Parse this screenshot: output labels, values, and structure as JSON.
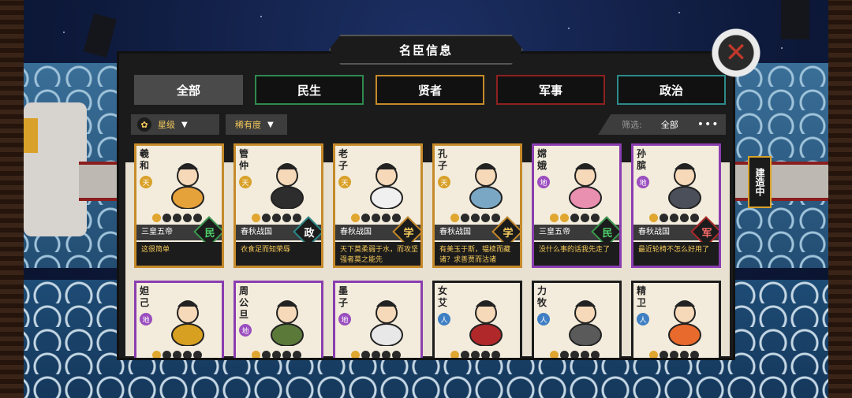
{
  "title": "名臣信息",
  "close_label": "✕",
  "tabs": [
    {
      "label": "全部",
      "active": true
    },
    {
      "label": "民生"
    },
    {
      "label": "贤者"
    },
    {
      "label": "军事"
    },
    {
      "label": "政治"
    }
  ],
  "filters": {
    "star_icon": "✿",
    "star_label": "星级",
    "rarity_label": "稀有度",
    "screen_label": "筛选:",
    "screen_value": "全部",
    "more": "•••"
  },
  "side_button": "建造中",
  "cards": [
    {
      "name": "羲和",
      "grade": "天",
      "era": "三皇五帝",
      "category": "民",
      "quote": "这很简单",
      "stars": 1
    },
    {
      "name": "管仲",
      "grade": "天",
      "era": "春秋战国",
      "category": "政",
      "quote": "衣食足而知荣辱",
      "stars": 1
    },
    {
      "name": "老子",
      "grade": "天",
      "era": "春秋战国",
      "category": "学",
      "quote": "天下莫柔弱于水，而攻坚强者莫之能先",
      "stars": 1
    },
    {
      "name": "孔子",
      "grade": "天",
      "era": "春秋战国",
      "category": "学",
      "quote": "有美玉于斯，韫椟而藏诸？求善贾而沽诸",
      "stars": 1
    },
    {
      "name": "嫦娥",
      "grade": "地",
      "era": "三皇五帝",
      "category": "民",
      "quote": "没什么事的话我先走了",
      "stars": 2
    },
    {
      "name": "孙膑",
      "grade": "地",
      "era": "春秋战国",
      "category": "军",
      "quote": "最近轮椅不怎么好用了",
      "stars": 1
    },
    {
      "name": "妲己",
      "grade": "地",
      "stars": 1
    },
    {
      "name": "周公旦",
      "grade": "地",
      "stars": 1
    },
    {
      "name": "墨子",
      "grade": "地",
      "stars": 1
    },
    {
      "name": "女艾",
      "grade": "人",
      "stars": 1
    },
    {
      "name": "力牧",
      "grade": "人",
      "stars": 1
    },
    {
      "name": "精卫",
      "grade": "人",
      "stars": 1
    }
  ],
  "colors": {
    "tian": "#d9a12a",
    "di": "#9b4fbf",
    "ren": "#3f7fc3",
    "accent_gold": "#f4c95a"
  }
}
